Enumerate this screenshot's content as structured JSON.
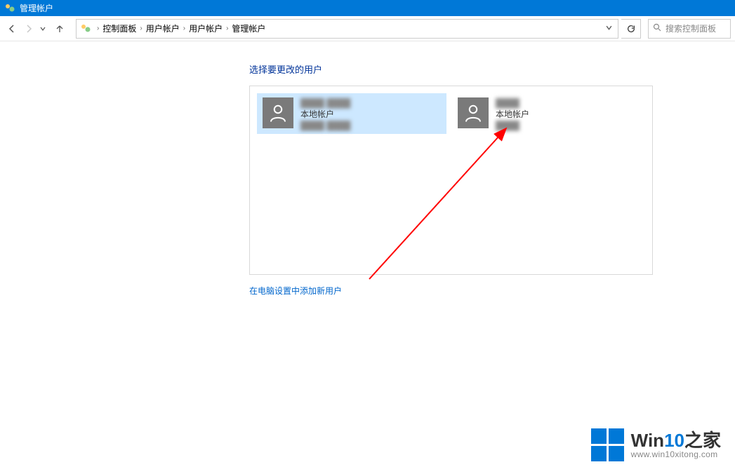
{
  "window": {
    "title": "管理帐户"
  },
  "breadcrumb": {
    "items": [
      "控制面板",
      "用户帐户",
      "用户帐户",
      "管理帐户"
    ]
  },
  "search": {
    "placeholder": "搜索控制面板"
  },
  "page": {
    "heading": "选择要更改的用户",
    "add_user_link": "在电脑设置中添加新用户"
  },
  "accounts": [
    {
      "name": "████ ████",
      "type": "本地帐户",
      "extra": "████ ████",
      "selected": true
    },
    {
      "name": "████",
      "type": "本地帐户",
      "extra": "████",
      "selected": false
    }
  ],
  "watermark": {
    "brand_prefix": "Win",
    "brand_accent": "10",
    "brand_suffix": "之家",
    "url": "www.win10xitong.com"
  }
}
